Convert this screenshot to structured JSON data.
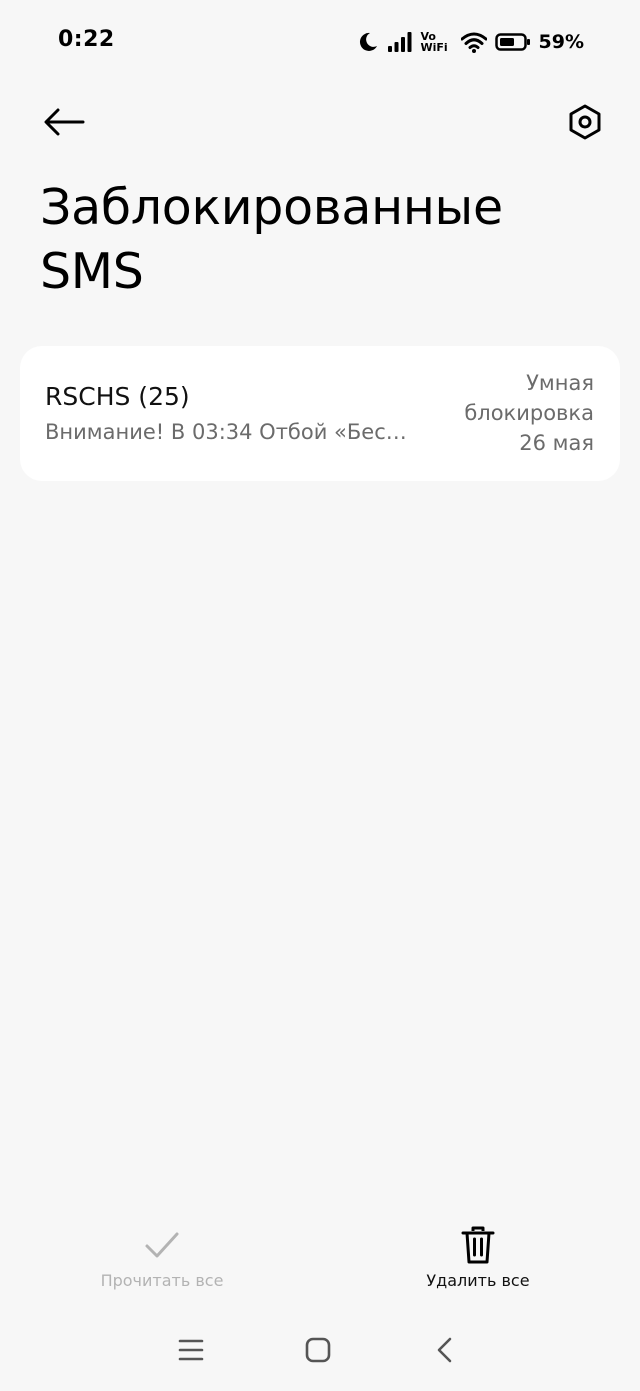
{
  "status_bar": {
    "time": "0:22",
    "vowifi_top": "Vo",
    "vowifi_bottom": "WiFi",
    "battery_percent": "59%"
  },
  "header": {
    "title": "Заблокированные SMS"
  },
  "messages": [
    {
      "sender": "RSCHS (25)",
      "preview": "Внимание! В 03:34 Отбой «Бес…",
      "block_type": "Умная блокировка",
      "date": "26 мая"
    }
  ],
  "actions": {
    "read_all": "Прочитать все",
    "delete_all": "Удалить все"
  },
  "colors": {
    "background": "#f7f7f7",
    "card": "#ffffff",
    "secondary_text": "#6b6b6b",
    "disabled": "#b3b3b3"
  },
  "icons": {
    "back": "arrow-left-icon",
    "settings": "hexagon-gear-icon",
    "read_all": "checkmark-icon",
    "delete_all": "trash-icon"
  }
}
